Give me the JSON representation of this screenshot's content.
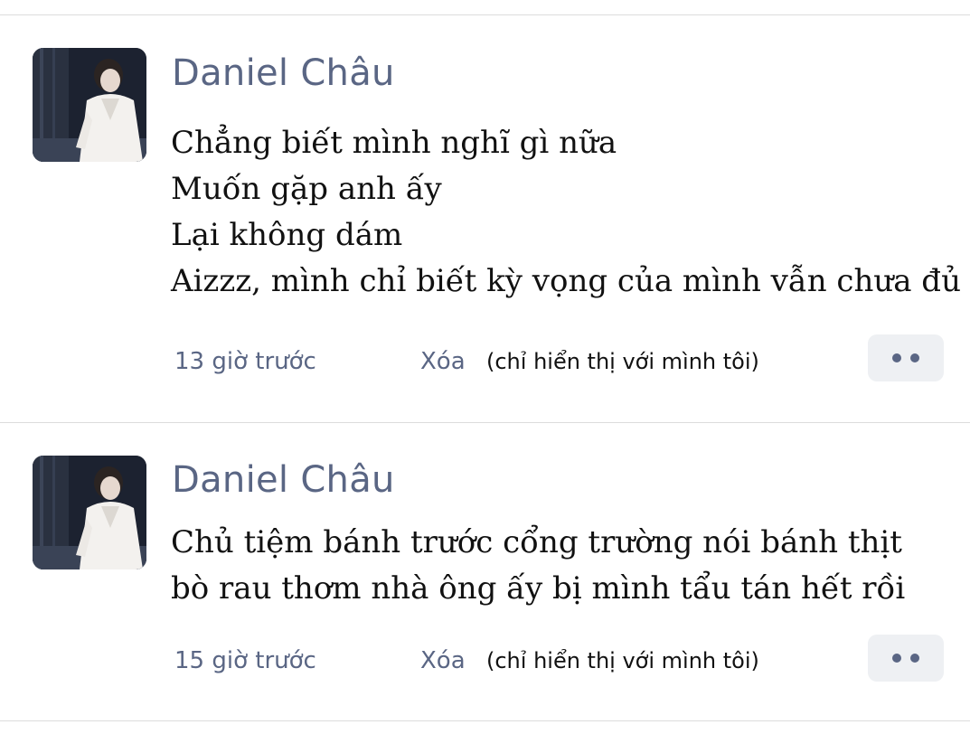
{
  "posts": [
    {
      "author": "Daniel Châu",
      "lines": [
        "Chẳng biết mình nghĩ gì nữa",
        "Muốn gặp anh ấy",
        "Lại không dám",
        "Aizzz, mình chỉ biết kỳ vọng của mình vẫn chưa đủ"
      ],
      "time": "13 giờ trước",
      "delete_label": "Xóa",
      "visibility_note": "(chỉ hiển thị với mình tôi)",
      "more_icon": "more-dots-icon"
    },
    {
      "author": "Daniel Châu",
      "lines": [
        "Chủ tiệm bánh trước cổng trường nói bánh thịt",
        "bò rau thơm nhà ông ấy bị mình tẩu tán hết rồi"
      ],
      "time": "15 giờ trước",
      "delete_label": "Xóa",
      "visibility_note": "(chỉ hiển thị với mình tôi)",
      "more_icon": "more-dots-icon"
    }
  ],
  "colors": {
    "author": "#5a6684",
    "meta": "#5a6684",
    "text": "#111111",
    "divider": "#dcdcdc",
    "more_button_bg": "#eef0f3"
  }
}
